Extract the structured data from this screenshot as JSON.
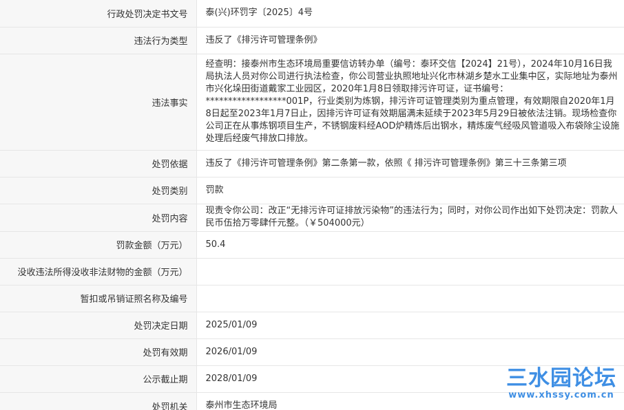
{
  "rows": [
    {
      "label": "行政处罚决定书文号",
      "value": "泰(兴)环罚字〔2025〕4号"
    },
    {
      "label": "违法行为类型",
      "value": "违反了《排污许可管理条例》"
    },
    {
      "label": "违法事实",
      "value": "经查明：接泰州市生态环境局重要信访转办单（编号：泰环交信【2024】21号），2024年10月16日我局执法人员对你公司进行执法检查，你公司营业执照地址兴化市林湖乡楚水工业集中区，实际地址为泰州市兴化垛田街道戴家工业园区，2020年1月8日领取排污许可证，证书编号：******************001P，行业类别为炼钢，排污许可证管理类别为重点管理，有效期限自2020年1月8日起至2023年1月7日止，因排污许可证有效期届满未延续于2023年5月29日被依法注销。现场检查你公司正在从事炼钢项目生产，不锈钢废料经AOD炉精炼后出钢水，精炼废气经吸风管道吸入布袋除尘设施处理后经废气排放口排放。"
    },
    {
      "label": "处罚依据",
      "value": "违反了《排污许可管理条例》第二条第一款，依照《 排污许可管理条例》第三十三条第三项"
    },
    {
      "label": "处罚类别",
      "value": "罚款"
    },
    {
      "label": "处罚内容",
      "value": "现责令你公司：改正“无排污许可证排放污染物”的违法行为；同时，对你公司作出如下处罚决定：罚款人民币伍拾万零肆仟元整。（￥504000元）"
    },
    {
      "label": "罚款金额（万元）",
      "value": "50.4"
    },
    {
      "label": "没收违法所得没收非法财物的金额（万元）",
      "value": ""
    },
    {
      "label": "暂扣或吊销证照名称及编号",
      "value": ""
    },
    {
      "label": "处罚决定日期",
      "value": "2025/01/09"
    },
    {
      "label": "处罚有效期",
      "value": "2026/01/09"
    },
    {
      "label": "公示截止期",
      "value": "2028/01/09"
    },
    {
      "label": "处罚机关",
      "value": "泰州市生态环境局"
    }
  ],
  "watermark": {
    "title": "三水园论坛",
    "url": "www.xhssy.com.cn"
  }
}
